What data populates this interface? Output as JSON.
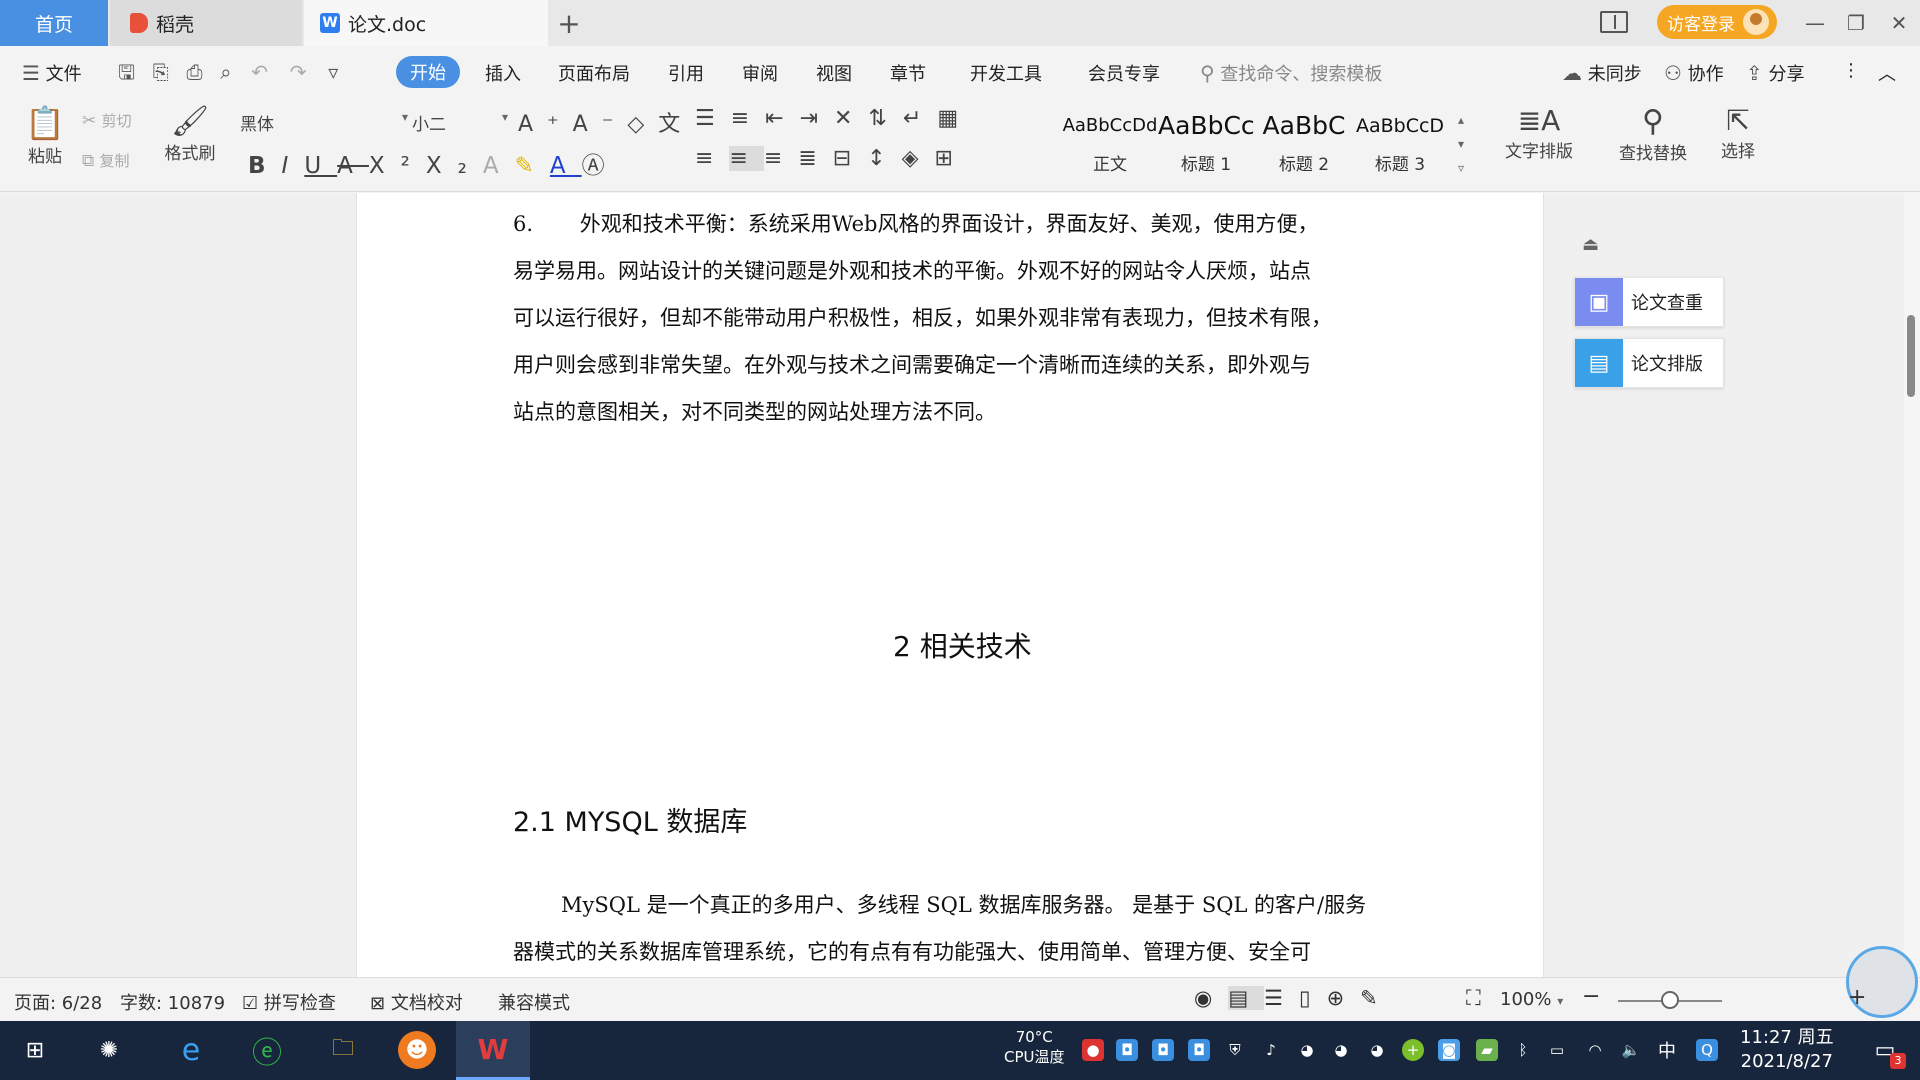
{
  "titlebar": {
    "tabs": [
      {
        "label": "首页"
      },
      {
        "label": "稻壳"
      },
      {
        "label": "论文.doc"
      }
    ],
    "login_label": "访客登录"
  },
  "menubar": {
    "file": "文件",
    "start": "开始",
    "items": [
      "插入",
      "页面布局",
      "引用",
      "审阅",
      "视图",
      "章节",
      "开发工具",
      "会员专享"
    ],
    "search_placeholder": "查找命令、搜索模板",
    "unsync": "未同步",
    "collab": "协作",
    "share": "分享"
  },
  "ribbon": {
    "paste": "粘贴",
    "cut": "剪切",
    "copy": "复制",
    "format_painter": "格式刷",
    "font_name": "黑体",
    "font_size": "小二",
    "styles": [
      {
        "sample": "AaBbCcDd",
        "name": "正文"
      },
      {
        "sample": "AaBbCc",
        "name": "标题 1"
      },
      {
        "sample": "AaBbC",
        "name": "标题 2"
      },
      {
        "sample": "AaBbCcD",
        "name": "标题 3"
      }
    ],
    "text_layout": "文字排版",
    "find_replace": "查找替换",
    "select": "选择"
  },
  "document": {
    "para1_lines": [
      "6.       外观和技术平衡：系统采用Web风格的界面设计，界面友好、美观，使用方便，",
      "易学易用。网站设计的关键问题是外观和技术的平衡。外观不好的网站令人厌烦，站点",
      "可以运行很好，但却不能带动用户积极性，相反，如果外观非常有表现力，但技术有限，",
      "用户则会感到非常失望。在外观与技术之间需要确定一个清晰而连续的关系，即外观与",
      "站点的意图相关，对不同类型的网站处理方法不同。"
    ],
    "heading2": "2 相关技术",
    "heading21": "2.1 MYSQL 数据库",
    "para2_lines": [
      "MySQL 是一个真正的多用户、多线程 SQL 数据库服务器。 是基于 SQL 的客户/服务",
      "器模式的关系数据库管理系统，它的有点有有功能强大、使用简单、管理方便、安全可"
    ]
  },
  "side_panel": {
    "check": "论文查重",
    "layout": "论文排版"
  },
  "statusbar": {
    "page": "页面: 6/28",
    "words": "字数: 10879",
    "spell": "拼写检查",
    "proof": "文档校对",
    "compat": "兼容模式",
    "zoom": "100%",
    "zoom_fraction": 0.5
  },
  "taskbar": {
    "cpu_temp": "70°C",
    "cpu_label": "CPU温度",
    "ime": "中",
    "time": "11:27 周五",
    "date": "2021/8/27",
    "notif_count": "3"
  }
}
